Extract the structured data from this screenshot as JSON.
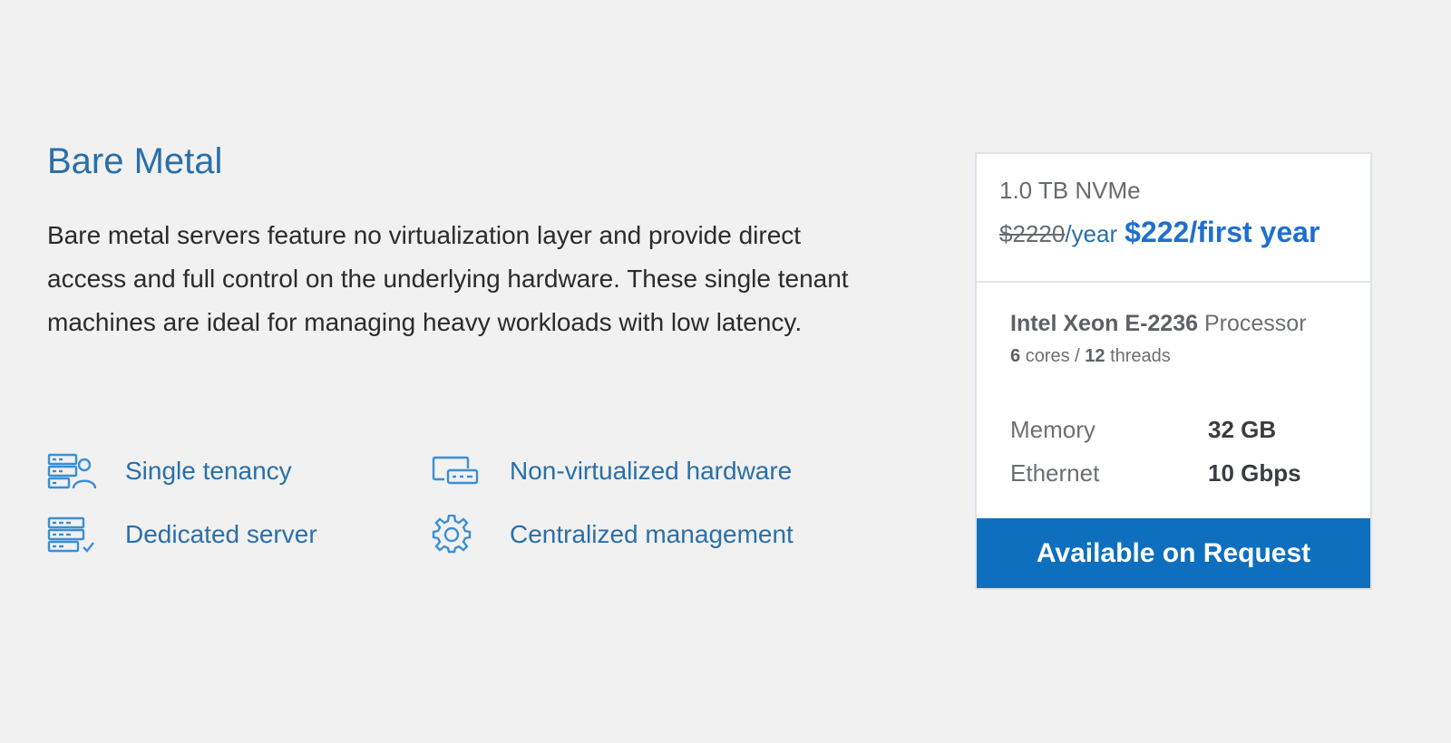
{
  "section": {
    "title": "Bare Metal",
    "description": "Bare metal servers feature no virtualization layer and provide direct access and full control on the underlying hardware. These single tenant machines are ideal for managing heavy workloads with low latency."
  },
  "features": [
    {
      "label": "Single tenancy",
      "icon": "server-user-icon"
    },
    {
      "label": "Dedicated server",
      "icon": "server-check-icon"
    },
    {
      "label": "Non-virtualized hardware",
      "icon": "hardware-devices-icon"
    },
    {
      "label": "Centralized management",
      "icon": "gear-icon"
    }
  ],
  "plan_card": {
    "storage": "1.0 TB NVMe",
    "old_price": "$2220",
    "per_year": "/year",
    "new_price": "$222/first year",
    "cpu_model": "Intel Xeon E-2236",
    "cpu_suffix": "Processor",
    "cores": "6",
    "cores_label": "cores /",
    "threads": "12",
    "threads_label": "threads",
    "specs": [
      {
        "key": "Memory",
        "value": "32 GB"
      },
      {
        "key": "Ethernet",
        "value": "10 Gbps"
      }
    ],
    "cta_label": "Available on Request"
  },
  "colors": {
    "background": "#f1f1f1",
    "heading_blue": "#2a6fa8",
    "price_blue": "#1f6fd1",
    "button_blue": "#0d6fbd",
    "icon_blue": "#3a8fd6"
  }
}
